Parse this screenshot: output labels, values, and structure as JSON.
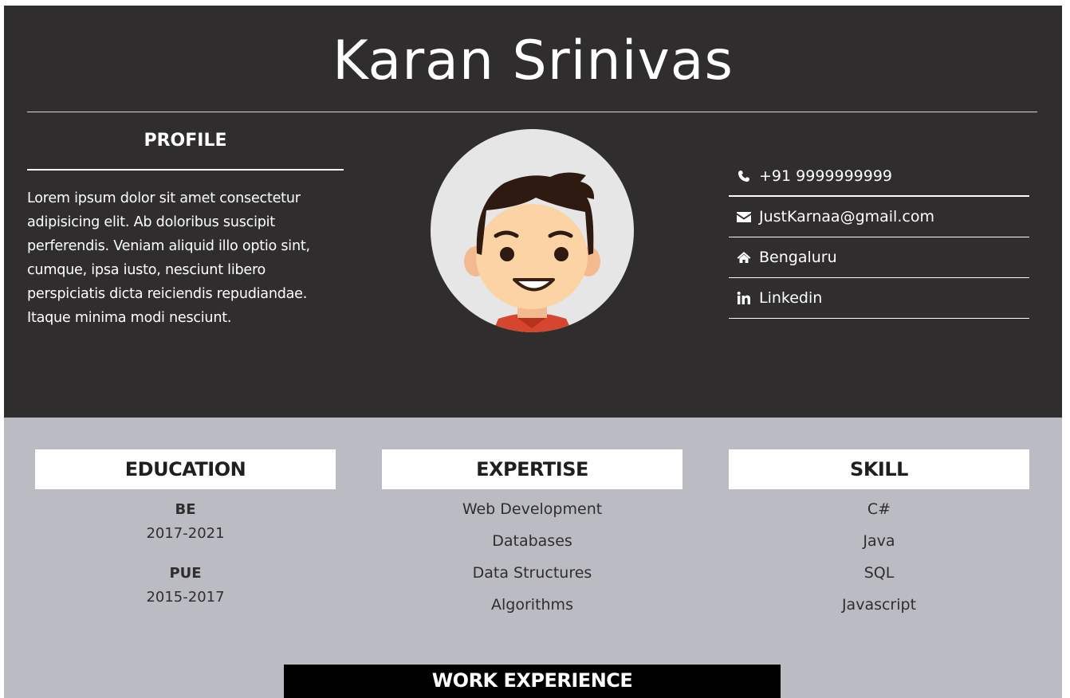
{
  "header": {
    "name": "Karan Srinivas"
  },
  "profile": {
    "title": "PROFILE",
    "text": "Lorem ipsum dolor sit amet consectetur adipisicing elit. Ab doloribus suscipit perferendis. Veniam aliquid illo optio sint, cumque, ipsa iusto, nesciunt libero perspiciatis dicta reiciendis repudiandae. Itaque minima modi nesciunt."
  },
  "avatar": {
    "icon": "cartoon-avatar"
  },
  "contacts": [
    {
      "icon": "phone-icon",
      "text": "+91 9999999999"
    },
    {
      "icon": "envelope-icon",
      "text": "JustKarnaa@gmail.com"
    },
    {
      "icon": "home-icon",
      "text": "Bengaluru"
    },
    {
      "icon": "linkedin-icon",
      "text": "Linkedin"
    }
  ],
  "education": {
    "title": "EDUCATION",
    "items": [
      {
        "degree": "BE",
        "years": "2017-2021"
      },
      {
        "degree": "PUE",
        "years": "2015-2017"
      }
    ]
  },
  "expertise": {
    "title": "EXPERTISE",
    "items": [
      "Web Development",
      "Databases",
      "Data Structures",
      "Algorithms"
    ]
  },
  "skill": {
    "title": "SKILL",
    "items": [
      "C#",
      "Java",
      "SQL",
      "Javascript"
    ]
  },
  "work": {
    "title": "WORK EXPERIENCE"
  },
  "colors": {
    "dark": "#2f2d2e",
    "light_gray": "#bbbcc3",
    "white": "#ffffff",
    "black": "#000000"
  }
}
